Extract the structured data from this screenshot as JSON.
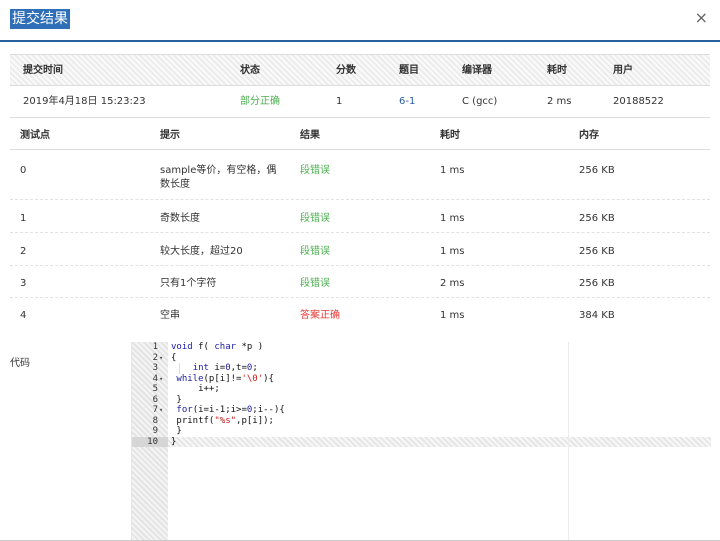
{
  "header": {
    "title": "提交结果",
    "close": "×"
  },
  "summary": {
    "headers": [
      "提交时间",
      "状态",
      "分数",
      "题目",
      "编译器",
      "耗时",
      "用户"
    ],
    "row": {
      "time": "2019年4月18日 15:23:23",
      "status": "部分正确",
      "score": "1",
      "problem": "6-1",
      "compiler": "C (gcc)",
      "duration": "2 ms",
      "user": "20188522"
    }
  },
  "tests": {
    "headers": [
      "测试点",
      "提示",
      "结果",
      "耗时",
      "内存"
    ],
    "rows": [
      {
        "id": "0",
        "tip": "sample等价，有空格，偶数长度",
        "result": "段错误",
        "time": "1 ms",
        "memory": "256 KB"
      },
      {
        "id": "1",
        "tip": "奇数长度",
        "result": "段错误",
        "time": "1 ms",
        "memory": "256 KB"
      },
      {
        "id": "2",
        "tip": "较大长度，超过20",
        "result": "段错误",
        "time": "1 ms",
        "memory": "256 KB"
      },
      {
        "id": "3",
        "tip": "只有1个字符",
        "result": "段错误",
        "time": "2 ms",
        "memory": "256 KB"
      },
      {
        "id": "4",
        "tip": "空串",
        "result": "答案正确",
        "time": "1 ms",
        "memory": "384 KB"
      }
    ]
  },
  "code": {
    "label": "代码",
    "lines": [
      {
        "n": "1",
        "fold": "",
        "text": "void f( char *p )"
      },
      {
        "n": "2",
        "fold": "▾",
        "text": "{"
      },
      {
        "n": "3",
        "fold": "",
        "text": "    int i=0,t=0;"
      },
      {
        "n": "4",
        "fold": "▾",
        "text": " while(p[i]!='\\0'){"
      },
      {
        "n": "5",
        "fold": "",
        "text": "     i++;"
      },
      {
        "n": "6",
        "fold": "",
        "text": " }"
      },
      {
        "n": "7",
        "fold": "▾",
        "text": " for(i=i-1;i>=0;i--){"
      },
      {
        "n": "8",
        "fold": "",
        "text": " printf(\"%s\",p[i]);"
      },
      {
        "n": "9",
        "fold": "",
        "text": " }"
      },
      {
        "n": "10",
        "fold": "",
        "text": "}"
      }
    ]
  },
  "colors": {
    "accent": "#2f6fb8",
    "ok": "#4caf50",
    "error": "#e53935",
    "link": "#2a5f9e"
  }
}
